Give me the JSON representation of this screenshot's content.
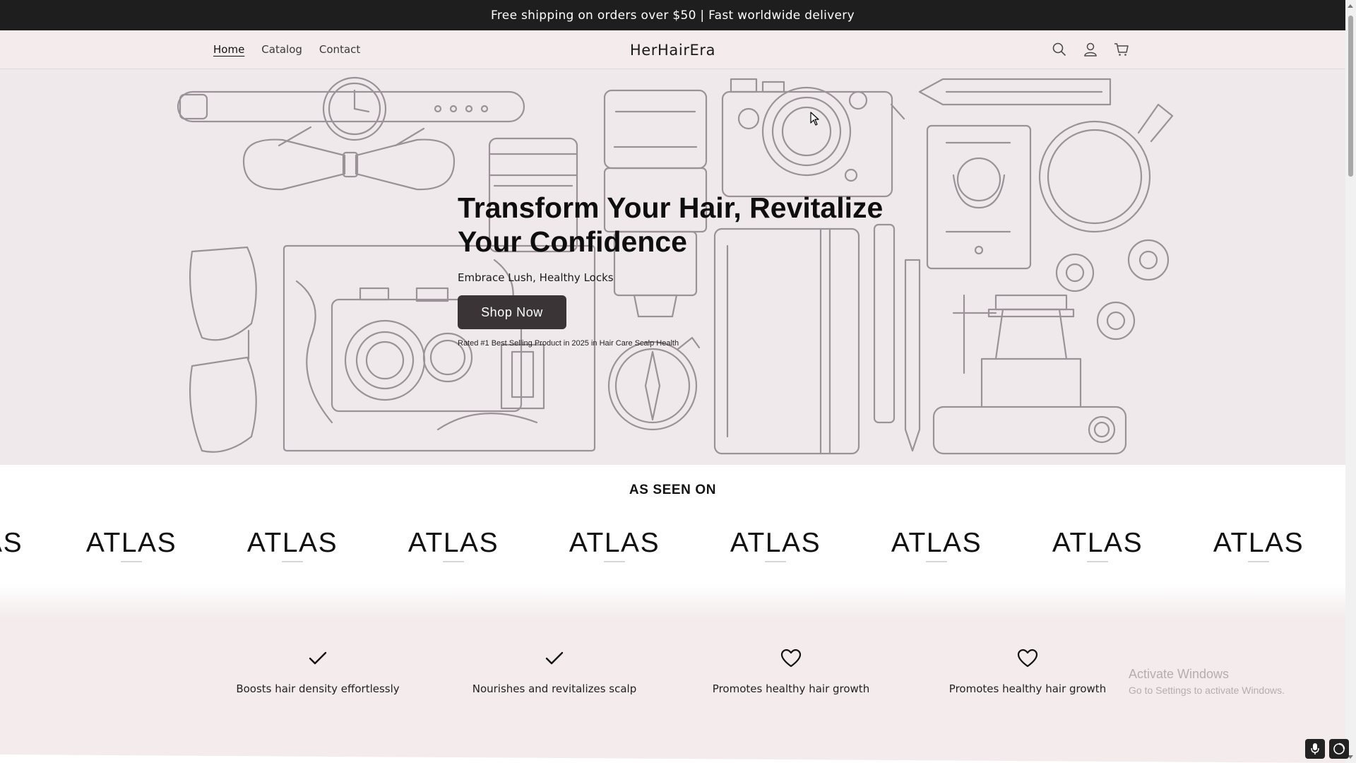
{
  "announcement": "Free shipping on orders over $50 | Fast worldwide delivery",
  "header": {
    "brand": "HerHairEra",
    "nav": [
      {
        "label": "Home",
        "active": true
      },
      {
        "label": "Catalog",
        "active": false
      },
      {
        "label": "Contact",
        "active": false
      }
    ],
    "icons": [
      "search-icon",
      "account-icon",
      "cart-icon"
    ]
  },
  "hero": {
    "title": "Transform Your Hair, Revitalize Your Confidence",
    "subtitle": "Embrace Lush, Healthy Locks",
    "cta": "Shop Now",
    "rating_note": "Rated #1 Best Selling Product in 2025 in Hair Care Scalp Health"
  },
  "as_seen_on": {
    "heading": "AS SEEN ON",
    "logos": [
      "ATLAS",
      "ATLAS",
      "ATLAS",
      "ATLAS",
      "ATLAS",
      "ATLAS",
      "ATLAS",
      "ATLAS",
      "ATLAS"
    ]
  },
  "features": [
    {
      "icon": "check-icon",
      "label": "Boosts hair density effortlessly"
    },
    {
      "icon": "check-icon",
      "label": "Nourishes and revitalizes scalp"
    },
    {
      "icon": "heart-icon",
      "label": "Promotes healthy hair growth"
    },
    {
      "icon": "heart-icon",
      "label": "Promotes healthy hair growth"
    }
  ],
  "watermark": {
    "title": "Activate Windows",
    "subtitle": "Go to Settings to activate Windows."
  },
  "colors": {
    "header_bg": "#f3ebec",
    "hero_bg": "#f0e9ec",
    "button_bg": "#3b3436",
    "announcement_bg": "#1e1e1e"
  }
}
